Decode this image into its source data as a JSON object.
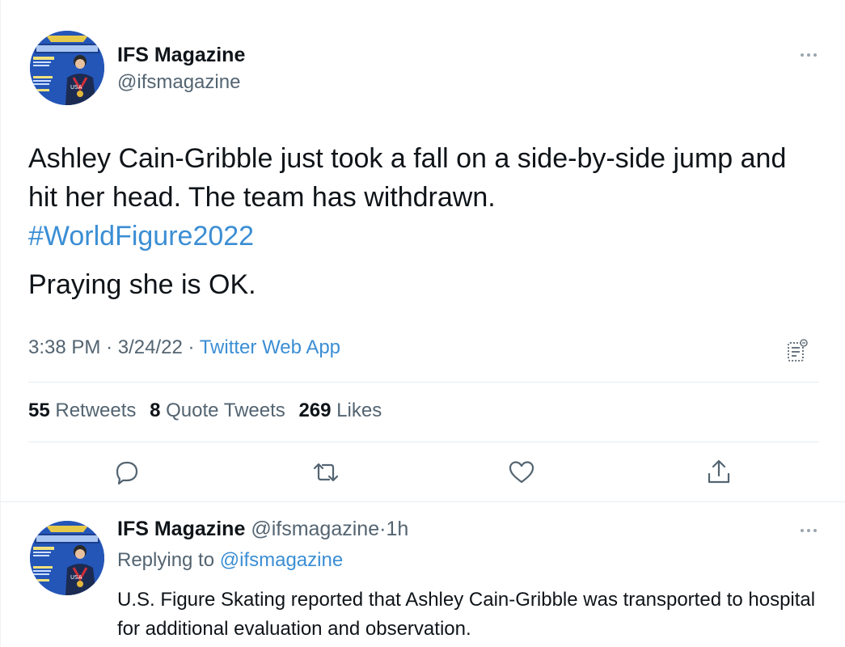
{
  "main_tweet": {
    "author": {
      "name": "IFS Magazine",
      "handle": "@ifsmagazine",
      "avatar_icon": "magazine-cover-avatar"
    },
    "text_line1": "Ashley Cain-Gribble just took a fall on a side-by-side jump and hit her head. The team has withdrawn.",
    "hashtag": "#WorldFigure2022",
    "text_line2": "Praying she is OK.",
    "time": "3:38 PM",
    "dot1": "·",
    "date": "3/24/22",
    "dot2": "·",
    "app": "Twitter Web App",
    "stats": {
      "retweets_count": "55",
      "retweets_label": "Retweets",
      "quotes_count": "8",
      "quotes_label": "Quote Tweets",
      "likes_count": "269",
      "likes_label": "Likes"
    },
    "action_icons": [
      "reply-icon",
      "retweet-icon",
      "like-icon",
      "share-icon"
    ]
  },
  "reply_tweet": {
    "author": {
      "name": "IFS Magazine",
      "handle": "@ifsmagazine",
      "dot": "·",
      "time": "1h",
      "avatar_icon": "magazine-cover-avatar"
    },
    "replying_label": "Replying to",
    "replying_handle": "@ifsmagazine",
    "text": "U.S. Figure Skating reported that Ashley Cain-Gribble was transported to hospital for additional evaluation and observation."
  },
  "colors": {
    "link": "#3b8ed4",
    "secondary_text": "#536471",
    "primary_text": "#0f1419",
    "divider": "#e6ecf0"
  }
}
